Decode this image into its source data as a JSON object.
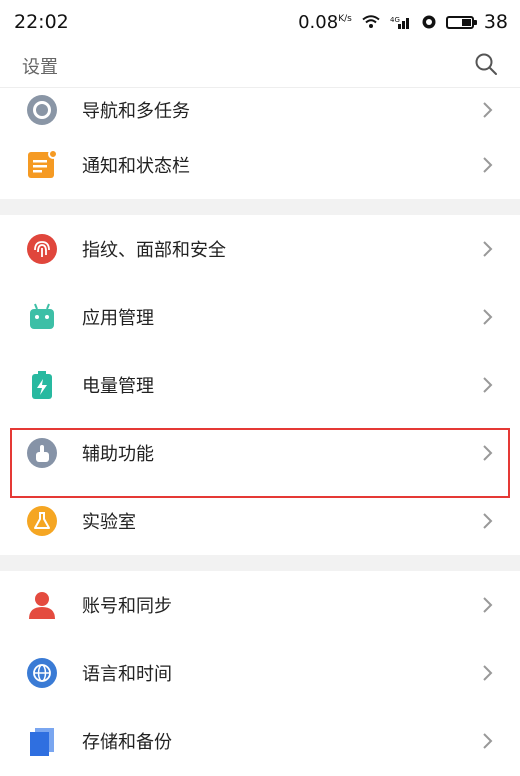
{
  "status_bar": {
    "time": "22:02",
    "net_speed": "0.08",
    "net_speed_unit": "K/s",
    "signal_label": "⁴ᴳ",
    "battery_level": "38"
  },
  "header": {
    "title": "设置"
  },
  "items": [
    {
      "label": "导航和多任务",
      "icon": "navigation-icon"
    },
    {
      "label": "通知和状态栏",
      "icon": "notification-icon"
    },
    {
      "label": "指纹、面部和安全",
      "icon": "fingerprint-icon"
    },
    {
      "label": "应用管理",
      "icon": "android-icon"
    },
    {
      "label": "电量管理",
      "icon": "battery-icon"
    },
    {
      "label": "辅助功能",
      "icon": "accessibility-icon"
    },
    {
      "label": "实验室",
      "icon": "flask-icon"
    },
    {
      "label": "账号和同步",
      "icon": "user-icon"
    },
    {
      "label": "语言和时间",
      "icon": "globe-icon"
    },
    {
      "label": "存储和备份",
      "icon": "storage-icon"
    }
  ],
  "colors": {
    "highlight": "#e53935",
    "navigation": "#8a96a6",
    "notification": "#f59a23",
    "fingerprint": "#e0463c",
    "apps": "#3dbfa6",
    "battery": "#28b9a0",
    "accessibility": "#8693a7",
    "lab": "#f5a623",
    "account": "#e44b3f",
    "language": "#3a7bd5",
    "storage": "#2f6fe0"
  }
}
